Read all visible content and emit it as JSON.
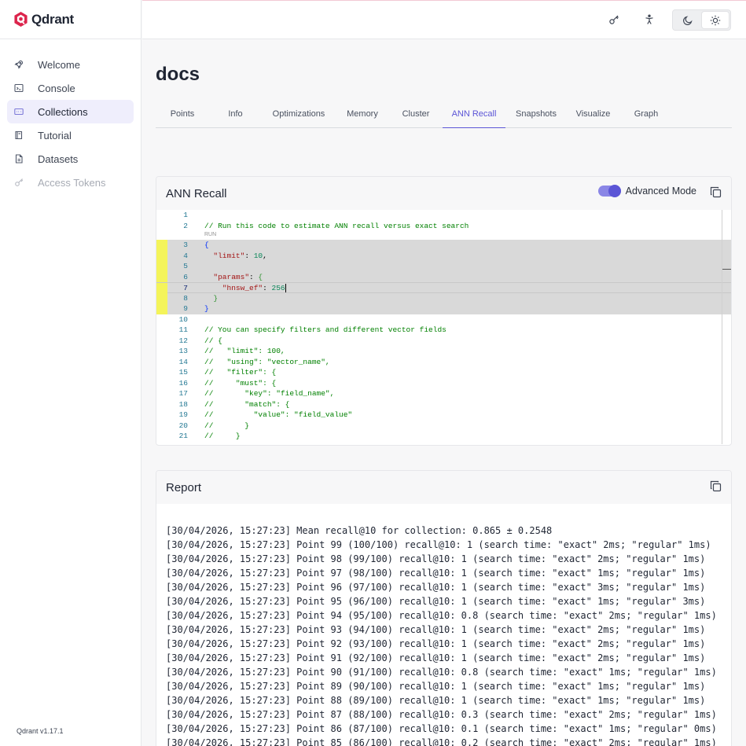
{
  "app": {
    "name": "Qdrant",
    "version": "Qdrant v1.17.1"
  },
  "sidebar": {
    "items": [
      {
        "label": "Welcome",
        "icon": "rocket-icon",
        "active": false,
        "disabled": false
      },
      {
        "label": "Console",
        "icon": "terminal-icon",
        "active": false,
        "disabled": false
      },
      {
        "label": "Collections",
        "icon": "collections-icon",
        "active": true,
        "disabled": false
      },
      {
        "label": "Tutorial",
        "icon": "book-icon",
        "active": false,
        "disabled": false
      },
      {
        "label": "Datasets",
        "icon": "file-icon",
        "active": false,
        "disabled": false
      },
      {
        "label": "Access Tokens",
        "icon": "key-icon",
        "active": false,
        "disabled": true
      }
    ]
  },
  "header": {
    "icons": [
      "key-icon",
      "accessibility-icon",
      "moon-icon",
      "sun-icon"
    ]
  },
  "page": {
    "title": "docs"
  },
  "tabs": [
    {
      "label": "Points",
      "active": false
    },
    {
      "label": "Info",
      "active": false
    },
    {
      "label": "Optimizations",
      "active": false
    },
    {
      "label": "Memory",
      "active": false
    },
    {
      "label": "Cluster",
      "active": false
    },
    {
      "label": "ANN Recall",
      "active": true
    },
    {
      "label": "Snapshots",
      "active": false
    },
    {
      "label": "Visualize",
      "active": false
    },
    {
      "label": "Graph",
      "active": false
    }
  ],
  "ann_card": {
    "title": "ANN Recall",
    "advanced_label": "Advanced Mode",
    "advanced_on": true,
    "run_lens": "RUN",
    "lines": [
      {
        "n": "1",
        "code": ""
      },
      {
        "n": "2",
        "code": "// Run this code to estimate ANN recall versus exact search"
      },
      {
        "n": "3",
        "code": "{"
      },
      {
        "n": "4",
        "code": "  \"limit\": 10,"
      },
      {
        "n": "5",
        "code": ""
      },
      {
        "n": "6",
        "code": "  \"params\": {"
      },
      {
        "n": "7",
        "code": "    \"hnsw_ef\": 256"
      },
      {
        "n": "8",
        "code": "  }"
      },
      {
        "n": "9",
        "code": "}"
      },
      {
        "n": "10",
        "code": ""
      },
      {
        "n": "11",
        "code": "// You can specify filters and different vector fields"
      },
      {
        "n": "12",
        "code": "// {"
      },
      {
        "n": "13",
        "code": "//   \"limit\": 100,"
      },
      {
        "n": "14",
        "code": "//   \"using\": \"vector_name\","
      },
      {
        "n": "15",
        "code": "//   \"filter\": {"
      },
      {
        "n": "16",
        "code": "//     \"must\": {"
      },
      {
        "n": "17",
        "code": "//       \"key\": \"field_name\","
      },
      {
        "n": "18",
        "code": "//       \"match\": {"
      },
      {
        "n": "19",
        "code": "//         \"value\": \"field_value\""
      },
      {
        "n": "20",
        "code": "//       }"
      },
      {
        "n": "21",
        "code": "//     }"
      }
    ]
  },
  "report_card": {
    "title": "Report",
    "lines": [
      "[30/04/2026, 15:27:23] Mean recall@10 for collection: 0.865 ± 0.2548",
      "[30/04/2026, 15:27:23] Point 99 (100/100) recall@10: 1 (search time: \"exact\" 2ms; \"regular\" 1ms)",
      "[30/04/2026, 15:27:23] Point 98 (99/100) recall@10: 1 (search time: \"exact\" 2ms; \"regular\" 1ms)",
      "[30/04/2026, 15:27:23] Point 97 (98/100) recall@10: 1 (search time: \"exact\" 1ms; \"regular\" 1ms)",
      "[30/04/2026, 15:27:23] Point 96 (97/100) recall@10: 1 (search time: \"exact\" 3ms; \"regular\" 1ms)",
      "[30/04/2026, 15:27:23] Point 95 (96/100) recall@10: 1 (search time: \"exact\" 1ms; \"regular\" 3ms)",
      "[30/04/2026, 15:27:23] Point 94 (95/100) recall@10: 0.8 (search time: \"exact\" 2ms; \"regular\" 1ms)",
      "[30/04/2026, 15:27:23] Point 93 (94/100) recall@10: 1 (search time: \"exact\" 2ms; \"regular\" 1ms)",
      "[30/04/2026, 15:27:23] Point 92 (93/100) recall@10: 1 (search time: \"exact\" 2ms; \"regular\" 1ms)",
      "[30/04/2026, 15:27:23] Point 91 (92/100) recall@10: 1 (search time: \"exact\" 2ms; \"regular\" 1ms)",
      "[30/04/2026, 15:27:23] Point 90 (91/100) recall@10: 0.8 (search time: \"exact\" 1ms; \"regular\" 1ms)",
      "[30/04/2026, 15:27:23] Point 89 (90/100) recall@10: 1 (search time: \"exact\" 1ms; \"regular\" 1ms)",
      "[30/04/2026, 15:27:23] Point 88 (89/100) recall@10: 1 (search time: \"exact\" 1ms; \"regular\" 1ms)",
      "[30/04/2026, 15:27:23] Point 87 (88/100) recall@10: 0.3 (search time: \"exact\" 2ms; \"regular\" 1ms)",
      "[30/04/2026, 15:27:23] Point 86 (87/100) recall@10: 0.1 (search time: \"exact\" 1ms; \"regular\" 0ms)",
      "[30/04/2026, 15:27:23] Point 85 (86/100) recall@10: 0.2 (search time: \"exact\" 2ms; \"regular\" 1ms)"
    ]
  },
  "colors": {
    "accent": "#5b55d6",
    "active_bg": "#efeefc",
    "highlight_gutter": "#f4f45a"
  }
}
